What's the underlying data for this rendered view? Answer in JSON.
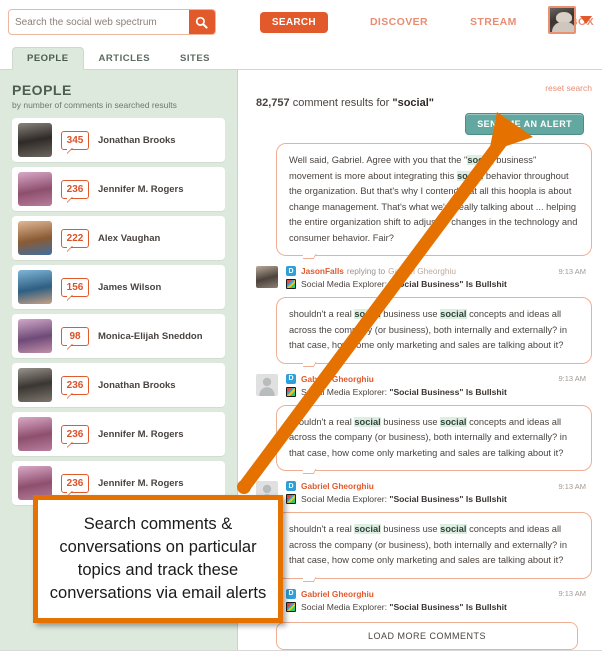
{
  "header": {
    "search": {
      "placeholder": "Search the social web spectrum",
      "value": "",
      "icon": "search-icon"
    },
    "search_button": "SEARCH",
    "nav": [
      {
        "label": "DISCOVER"
      },
      {
        "label": "STREAM"
      },
      {
        "label": "INBOX"
      }
    ],
    "user": {
      "avatar": "user-avatar",
      "caret": "chevron-down-icon"
    },
    "accent_orange": "#E2592C",
    "nav_link_color": "#E98D72"
  },
  "tabs": [
    {
      "label": "PEOPLE",
      "active": true
    },
    {
      "label": "ARTICLES",
      "active": false
    },
    {
      "label": "SITES",
      "active": false
    }
  ],
  "sidebar": {
    "title": "PEOPLE",
    "subtitle": "by number of comments in searched results",
    "background": "#DDE9DD",
    "people": [
      {
        "count": "345",
        "name": "Jonathan Brooks"
      },
      {
        "count": "236",
        "name": "Jennifer M. Rogers"
      },
      {
        "count": "222",
        "name": "Alex Vaughan"
      },
      {
        "count": "156",
        "name": "James Wilson"
      },
      {
        "count": "98",
        "name": "Monica-Elijah Sneddon"
      },
      {
        "count": "236",
        "name": "Jonathan Brooks"
      },
      {
        "count": "236",
        "name": "Jennifer M. Rogers"
      },
      {
        "count": "236",
        "name": "Jennifer M. Rogers"
      }
    ]
  },
  "content": {
    "reset_link": "reset search",
    "results_count": "82,757",
    "results_text_mid": " comment results for ",
    "results_query": "\"social\"",
    "alert_button": "SEND ME AN ALERT",
    "alert_button_color": "#62A8A0",
    "load_more": "LOAD MORE COMMENTS",
    "comments": [
      {
        "text_parts": [
          {
            "t": "Well said, Gabriel. Agree with you that the \"",
            "hl": false
          },
          {
            "t": "social",
            "hl": true
          },
          {
            "t": " business\" movement is more about integrating this ",
            "hl": false
          },
          {
            "t": "social",
            "hl": true
          },
          {
            "t": " behavior throughout the organization. But that's why I contend that all this hoopla is about change management. That's what we're really talking about ... helping the entire organization shift to adjust to changes in the technology and consumer behavior. Fair?",
            "hl": false
          }
        ],
        "author": "JasonFalls",
        "reply_verb": "replying to",
        "reply_to": "Gabriel Gheorghiu",
        "time": "9:13 AM",
        "source_prefix": "Social Media Explorer: ",
        "source_title": "\"Social Business\" Is Bullshit",
        "badge": "D"
      },
      {
        "text_parts": [
          {
            "t": "shouldn't a real ",
            "hl": false
          },
          {
            "t": "social",
            "hl": true
          },
          {
            "t": " business use ",
            "hl": false
          },
          {
            "t": "social",
            "hl": true
          },
          {
            "t": " concepts and ideas all across the company (or business), both internally and externally? in that case, how come only marketing and sales are talking about it?",
            "hl": false
          }
        ],
        "author": "Gabriel Gheorghiu",
        "reply_verb": "",
        "reply_to": "",
        "time": "9:13 AM",
        "source_prefix": "Social Media Explorer: ",
        "source_title": "\"Social Business\" Is Bullshit",
        "badge": "D"
      },
      {
        "text_parts": [
          {
            "t": "shouldn't a real ",
            "hl": false
          },
          {
            "t": "social",
            "hl": true
          },
          {
            "t": " business use ",
            "hl": false
          },
          {
            "t": "social",
            "hl": true
          },
          {
            "t": " concepts and ideas all across the company (or business), both internally and externally? in that case, how come only marketing and sales are talking about it?",
            "hl": false
          }
        ],
        "author": "Gabriel Gheorghiu",
        "reply_verb": "",
        "reply_to": "",
        "time": "9:13 AM",
        "source_prefix": "Social Media Explorer: ",
        "source_title": "\"Social Business\" Is Bullshit",
        "badge": "D"
      },
      {
        "text_parts": [
          {
            "t": "shouldn't a real ",
            "hl": false
          },
          {
            "t": "social",
            "hl": true
          },
          {
            "t": " business use ",
            "hl": false
          },
          {
            "t": "social",
            "hl": true
          },
          {
            "t": " concepts and ideas all across the company (or business), both internally and externally? in that case, how come only marketing and sales are talking about it?",
            "hl": false
          }
        ],
        "author": "Gabriel Gheorghiu",
        "reply_verb": "",
        "reply_to": "",
        "time": "9:13 AM",
        "source_prefix": "Social Media Explorer: ",
        "source_title": "\"Social Business\" Is Bullshit",
        "badge": "D"
      }
    ]
  },
  "annotation": {
    "text": "Search comments & conversations on particular topics and track these conversations via email alerts",
    "border_color": "#E57200",
    "arrow_color": "#E57200"
  }
}
